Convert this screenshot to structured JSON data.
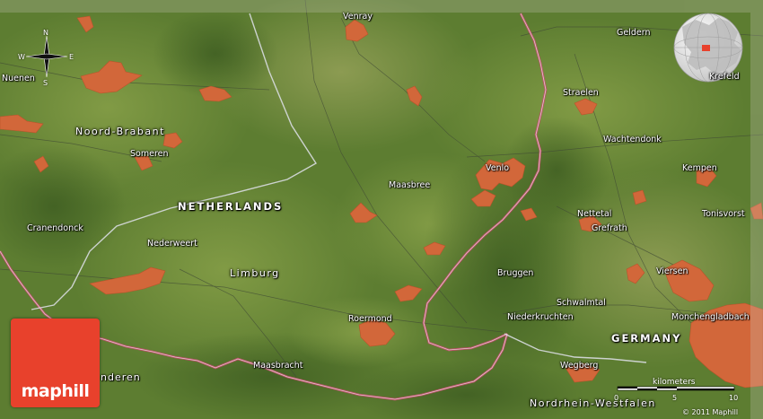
{
  "places": {
    "venray": "Venray",
    "geldern": "Geldern",
    "nuenen": "Nuenen",
    "straelen": "Straelen",
    "someren": "Someren",
    "wachtendonk": "Wachtendonk",
    "venlo": "Venlo",
    "maasbree": "Maasbree",
    "kempen": "Kempen",
    "cranendonck": "Cranendonck",
    "nederweert": "Nederweert",
    "nettetal": "Nettetal",
    "grefrath": "Grefrath",
    "tonisvorst": "Tonisvorst",
    "bruggen": "Bruggen",
    "viersen": "Viersen",
    "schwalmtal": "Schwalmtal",
    "roermond": "Roermond",
    "niederkruchten": "Niederkruchten",
    "monchengladbach": "Monchengladbach",
    "maasbracht": "Maasbracht",
    "wegberg": "Wegberg",
    "enderen": "nderen",
    "krefeld": "Krefeld"
  },
  "regions": {
    "noord_brabant": "Noord-Brabant",
    "limburg": "Limburg",
    "nordrhein_westfalen": "Nordrhein-Westfalen"
  },
  "countries": {
    "netherlands": "NETHERLANDS",
    "germany": "GERMANY"
  },
  "compass": {
    "n": "N",
    "s": "S",
    "e": "E",
    "w": "W"
  },
  "scale": {
    "title": "kilometers",
    "ticks": [
      "0",
      "5",
      "10"
    ]
  },
  "logo": {
    "text": "maphill"
  },
  "copyright": "© 2011 Maphill",
  "colors": {
    "terrain": "#5a7a2e",
    "urban": "#d2673a",
    "border": "#c0506a",
    "logo": "#e8412c"
  }
}
